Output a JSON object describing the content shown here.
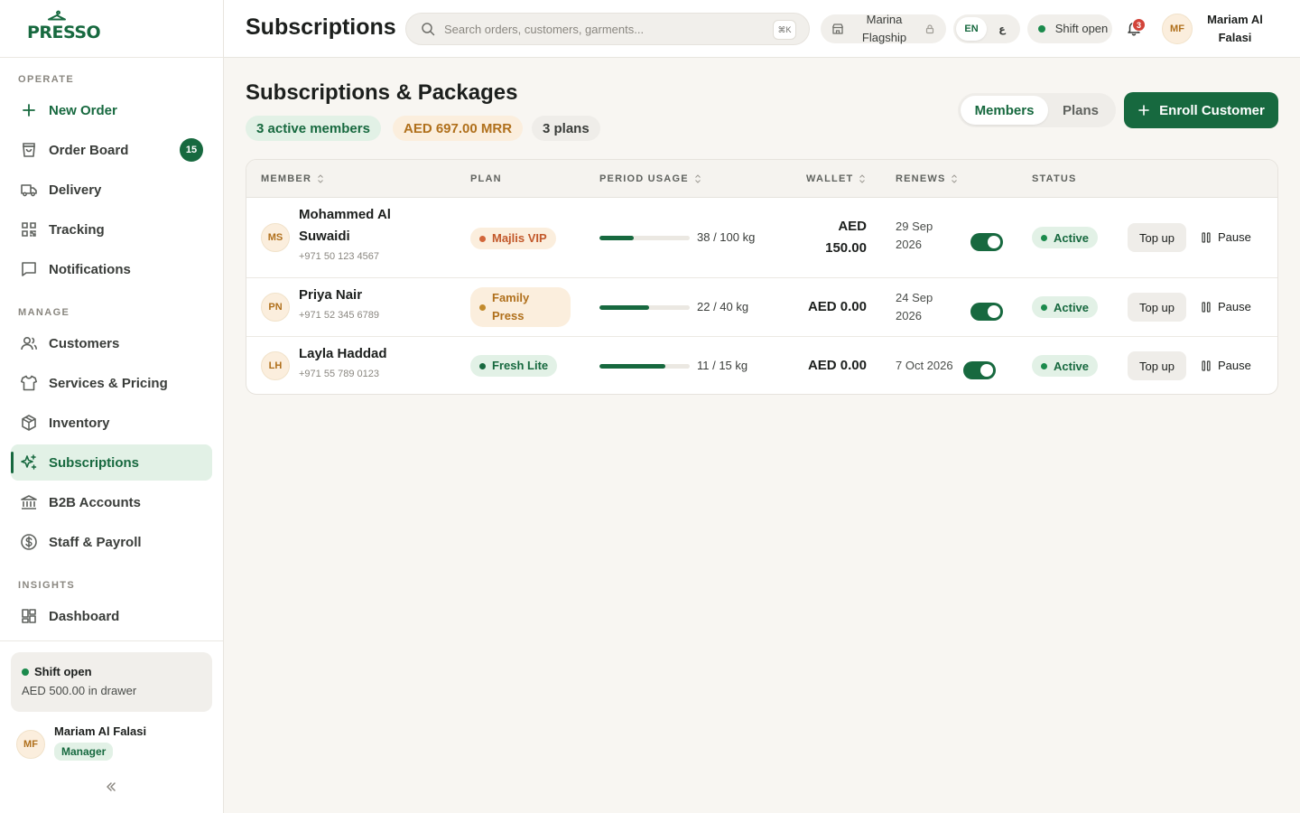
{
  "brand": {
    "logo_text": "PRESSO"
  },
  "sidebar": {
    "sections": {
      "operate": "OPERATE",
      "manage": "MANAGE",
      "insights": "INSIGHTS"
    },
    "items": [
      {
        "label": "New Order",
        "icon": "plus-icon"
      },
      {
        "label": "Order Board",
        "icon": "shopping-bag-icon",
        "badge": "15"
      },
      {
        "label": "Delivery",
        "icon": "truck-icon"
      },
      {
        "label": "Tracking",
        "icon": "qr-code-icon"
      },
      {
        "label": "Notifications",
        "icon": "message-square-icon"
      },
      {
        "label": "Customers",
        "icon": "users-icon"
      },
      {
        "label": "Services & Pricing",
        "icon": "shirt-icon"
      },
      {
        "label": "Inventory",
        "icon": "package-icon"
      },
      {
        "label": "Subscriptions",
        "icon": "sparkles-icon"
      },
      {
        "label": "B2B Accounts",
        "icon": "bank-icon"
      },
      {
        "label": "Staff & Payroll",
        "icon": "dollar-circle-icon"
      },
      {
        "label": "Dashboard",
        "icon": "layout-grid-icon"
      }
    ],
    "shift": {
      "status": "Shift open",
      "drawer": "AED 500.00 in drawer"
    },
    "user": {
      "initials": "MF",
      "name": "Mariam Al Falasi",
      "role": "Manager"
    }
  },
  "header": {
    "title": "Subscriptions",
    "search_placeholder": "Search orders, customers, garments...",
    "shortcut": "⌘K",
    "store": "Marina Flagship",
    "lang": {
      "en": "EN",
      "ar": "ع"
    },
    "shift": "Shift open",
    "notifications_count": "3",
    "user_initials": "MF",
    "user_name": "Mariam Al Falasi"
  },
  "main": {
    "title": "Subscriptions & Packages",
    "stats": {
      "members": "3 active members",
      "mrr": "AED 697.00 MRR",
      "plans": "3 plans"
    },
    "tabs": {
      "members": "Members",
      "plans": "Plans"
    },
    "enroll_label": "Enroll Customer"
  },
  "table": {
    "columns": {
      "member": "MEMBER",
      "plan": "PLAN",
      "usage": "PERIOD USAGE",
      "wallet": "WALLET",
      "renews": "RENEWS",
      "status": "STATUS"
    },
    "rows": [
      {
        "initials": "MS",
        "name": "Mohammed Al Suwaidi",
        "phone": "+971 50 123 4567",
        "plan": "Majlis VIP",
        "usage_text": "38 / 100 kg",
        "usage_fraction": 0.38,
        "wallet": "AED 150.00",
        "renews": "29 Sep 2026",
        "status": "Active",
        "topup": "Top up",
        "pause": "Pause"
      },
      {
        "initials": "PN",
        "name": "Priya Nair",
        "phone": "+971 52 345 6789",
        "plan": "Family Press",
        "usage_text": "22 / 40 kg",
        "usage_fraction": 0.55,
        "wallet": "AED 0.00",
        "renews": "24 Sep 2026",
        "status": "Active",
        "topup": "Top up",
        "pause": "Pause"
      },
      {
        "initials": "LH",
        "name": "Layla Haddad",
        "phone": "+971 55 789 0123",
        "plan": "Fresh Lite",
        "usage_text": "11 / 15 kg",
        "usage_fraction": 0.73,
        "wallet": "AED 0.00",
        "renews": "7 Oct 2026",
        "status": "Active",
        "topup": "Top up",
        "pause": "Pause"
      }
    ]
  },
  "colors": {
    "brand_green": "#17693f",
    "active_bg": "#e2f1e6",
    "amber": "#b0701c",
    "alert_red": "#d2443a"
  }
}
